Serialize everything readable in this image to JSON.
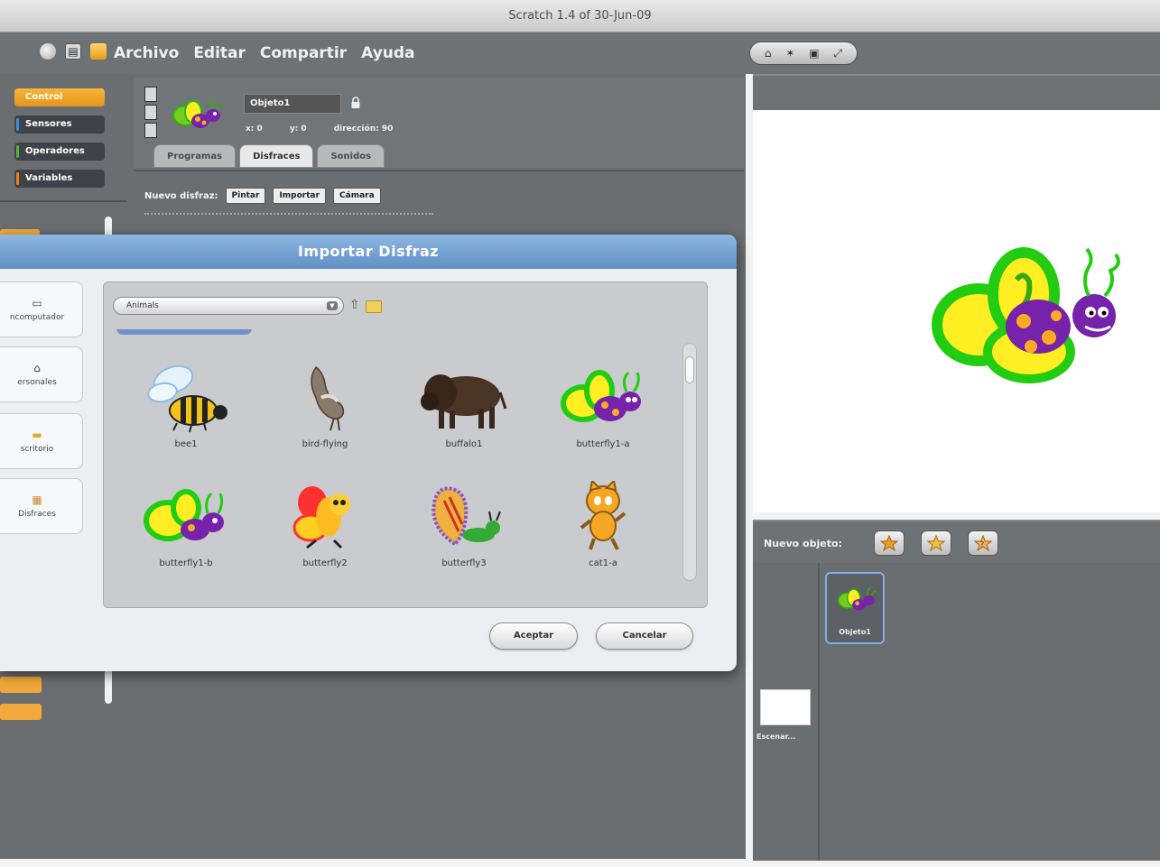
{
  "window": {
    "title": "Scratch 1.4 of 30-Jun-09"
  },
  "menu": {
    "items": [
      "Archivo",
      "Editar",
      "Compartir",
      "Ayuda"
    ],
    "view_modes": [
      "⌂",
      "✶",
      "▣",
      "⤢"
    ]
  },
  "categories": [
    {
      "label": "Control",
      "color": "#f0a020"
    },
    {
      "label": "Sensores",
      "color": "#3a8fd8"
    },
    {
      "label": "Operadores",
      "color": "#55b33a"
    },
    {
      "label": "Variables",
      "color": "#ee7d16"
    }
  ],
  "sprite": {
    "name": "Objeto1",
    "x": "x: 0",
    "y": "y: 0",
    "direction": "dirección: 90"
  },
  "tabs": [
    "Programas",
    "Disfraces",
    "Sonidos"
  ],
  "costume": {
    "new_label": "Nuevo disfraz:",
    "buttons": [
      "Pintar",
      "Importar",
      "Cámara"
    ]
  },
  "dialog": {
    "title": "Importar Disfraz",
    "shortcuts": [
      {
        "label": "ncomputador",
        "icon": "computer-icon"
      },
      {
        "label": "ersonales",
        "icon": "home-icon"
      },
      {
        "label": "scritorio",
        "icon": "desktop-icon"
      },
      {
        "label": "Disfraces",
        "icon": "costumes-icon"
      }
    ],
    "path": "Animals",
    "files": [
      {
        "name": "bee1"
      },
      {
        "name": "bird-flying"
      },
      {
        "name": "buffalo1"
      },
      {
        "name": "butterfly1-a"
      },
      {
        "name": "butterfly1-b"
      },
      {
        "name": "butterfly2"
      },
      {
        "name": "butterfly3"
      },
      {
        "name": "cat1-a"
      }
    ],
    "ok": "Aceptar",
    "cancel": "Cancelar"
  },
  "sprites_panel": {
    "new_label": "Nuevo objeto:",
    "stage_label": "Escenar...",
    "sprite_label": "Objeto1"
  }
}
